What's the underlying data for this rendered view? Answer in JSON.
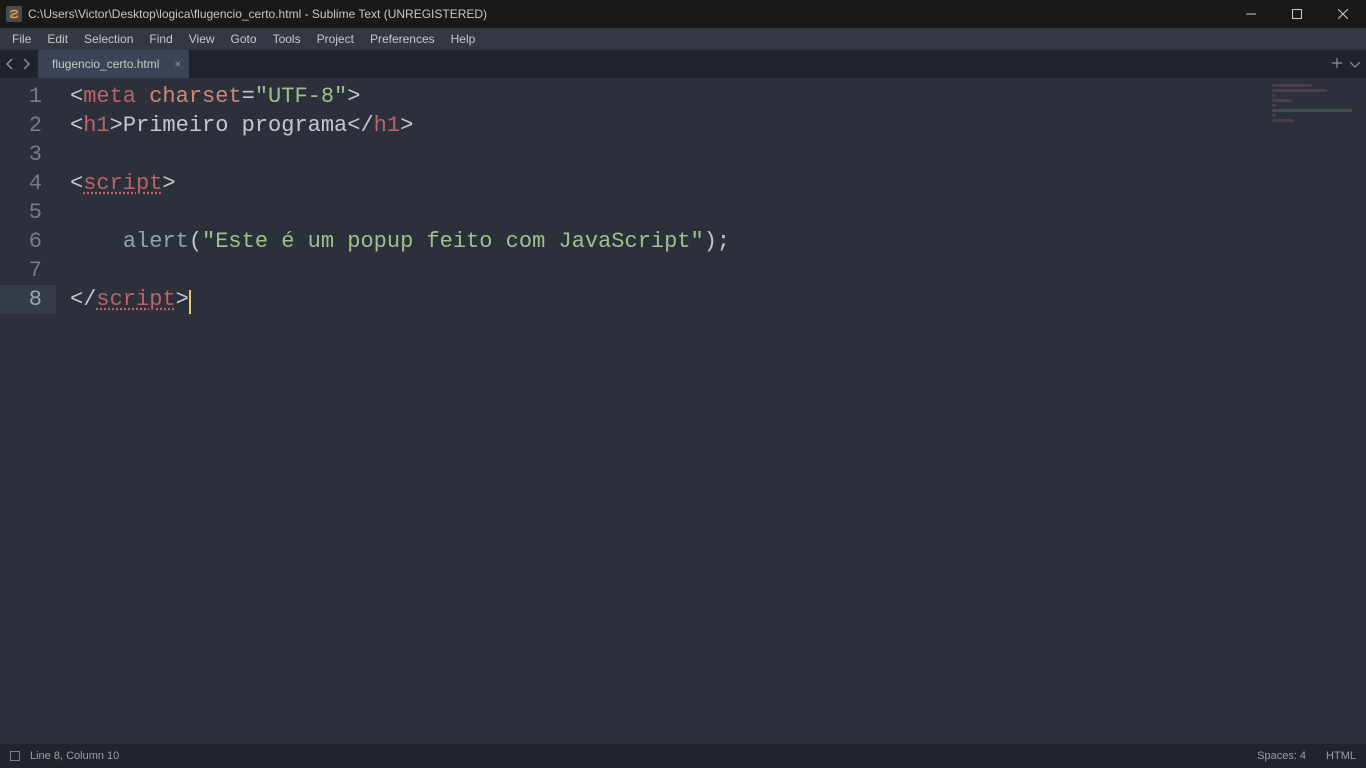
{
  "titlebar": {
    "title": "C:\\Users\\Victor\\Desktop\\logica\\flugencio_certo.html - Sublime Text (UNREGISTERED)"
  },
  "menu": {
    "items": [
      "File",
      "Edit",
      "Selection",
      "Find",
      "View",
      "Goto",
      "Tools",
      "Project",
      "Preferences",
      "Help"
    ]
  },
  "tabs": {
    "active": {
      "label": "flugencio_certo.html"
    }
  },
  "code": {
    "lines": [
      {
        "n": "1",
        "tokens": [
          {
            "c": "p-angle",
            "t": "<"
          },
          {
            "c": "p-tag",
            "t": "meta"
          },
          {
            "c": "",
            "t": " "
          },
          {
            "c": "p-attr",
            "t": "charset"
          },
          {
            "c": "p-punct",
            "t": "="
          },
          {
            "c": "p-str",
            "t": "\"UTF-8\""
          },
          {
            "c": "p-angle",
            "t": ">"
          }
        ]
      },
      {
        "n": "2",
        "tokens": [
          {
            "c": "p-angle",
            "t": "<"
          },
          {
            "c": "p-tag",
            "t": "h1"
          },
          {
            "c": "p-angle",
            "t": ">"
          },
          {
            "c": "p-text",
            "t": "Primeiro programa"
          },
          {
            "c": "p-angle",
            "t": "</"
          },
          {
            "c": "p-tag",
            "t": "h1"
          },
          {
            "c": "p-angle",
            "t": ">"
          }
        ]
      },
      {
        "n": "3",
        "tokens": []
      },
      {
        "n": "4",
        "tokens": [
          {
            "c": "p-angle",
            "t": "<"
          },
          {
            "c": "p-tag-u",
            "t": "script"
          },
          {
            "c": "p-angle",
            "t": ">"
          }
        ]
      },
      {
        "n": "5",
        "tokens": []
      },
      {
        "n": "6",
        "tokens": [
          {
            "c": "",
            "t": "    "
          },
          {
            "c": "p-func",
            "t": "alert"
          },
          {
            "c": "p-punct",
            "t": "("
          },
          {
            "c": "p-str",
            "t": "\"Este é um popup feito com JavaScript\""
          },
          {
            "c": "p-punct",
            "t": ");"
          }
        ]
      },
      {
        "n": "7",
        "tokens": []
      },
      {
        "n": "8",
        "current": true,
        "tokens": [
          {
            "c": "p-angle",
            "t": "</"
          },
          {
            "c": "p-tag-u",
            "t": "script"
          },
          {
            "c": "p-angle",
            "t": ">"
          }
        ]
      }
    ]
  },
  "status": {
    "position": "Line 8, Column 10",
    "spaces": "Spaces: 4",
    "syntax": "HTML"
  }
}
